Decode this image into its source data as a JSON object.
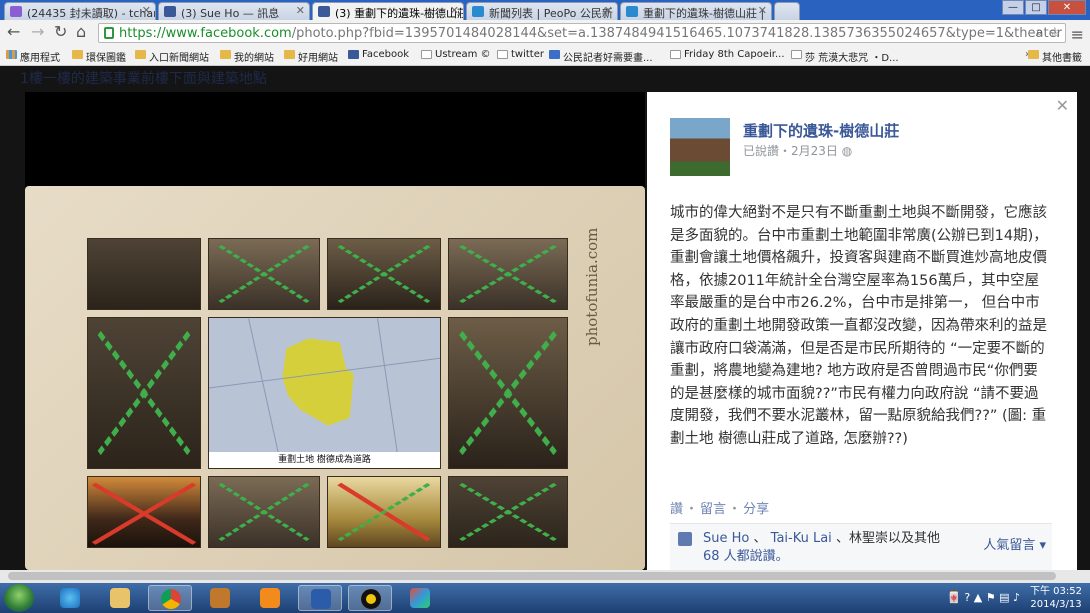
{
  "browser": {
    "tabs": [
      {
        "label": "(24435 封未讀取) - tchan",
        "icon": "gmail-icon",
        "color": "#8a5fd1"
      },
      {
        "label": "(3) Sue Ho — 訊息",
        "icon": "facebook-icon",
        "color": "#3b5998"
      },
      {
        "label": "(3) 重劃下的遺珠-樹德山莊",
        "icon": "facebook-icon",
        "color": "#3b5998"
      },
      {
        "label": "新聞列表 | PeoPo 公民新",
        "icon": "peopo-icon",
        "color": "#2a8ad0"
      },
      {
        "label": "重劃下的遺珠-樹德山莊 |",
        "icon": "peopo-icon",
        "color": "#2a8ad0"
      }
    ],
    "url_host": "https://www.facebook.com",
    "url_rest": "/photo.php?fbid=1395701484028144&set=a.1387484941516465.1073741828.1385736355024657&type=1&theater",
    "bookmarks": [
      {
        "label": "應用程式",
        "icon": "apps-icon"
      },
      {
        "label": "環保圖鑑",
        "icon": "folder-icon"
      },
      {
        "label": "入口新聞網站",
        "icon": "folder-icon"
      },
      {
        "label": "我的網站",
        "icon": "folder-icon"
      },
      {
        "label": "好用網站",
        "icon": "folder-icon"
      },
      {
        "label": "Facebook",
        "icon": "facebook-icon"
      },
      {
        "label": "Ustream ©",
        "icon": "page-icon"
      },
      {
        "label": "twitter",
        "icon": "page-icon"
      },
      {
        "label": "公民記者好需要畫...",
        "icon": "u-icon"
      },
      {
        "label": "Friday 8th Capoeir...",
        "icon": "page-icon"
      },
      {
        "label": "莎 荒漠大悲咒 ・D...",
        "icon": "page-icon"
      },
      {
        "label": "其他書籤",
        "icon": "folder-icon"
      }
    ]
  },
  "facebook": {
    "dim_header": "1樓一樓的建築事業前樓下面與建築地點",
    "watermark": "photofunia.com",
    "map_label": "重劃土地 樹德成為道路",
    "post": {
      "page_name": "重劃下的遺珠-樹德山莊",
      "meta": "已說讚・2月23日",
      "text": "城市的偉大絕對不是只有不斷重劃土地與不斷開發，它應該是多面貌的。台中市重劃土地範圍非常廣(公辦已到14期)，重劃會讓土地價格飆升，投資客與建商不斷買進炒高地皮價格，依據2011年統計全台灣空屋率為156萬戶，其中空屋率最嚴重的是台中市26.2%，台中市是排第一， 但台中市政府的重劃土地開發政策一直都沒改變，因為帶來利的益是讓市政府口袋滿滿，但是否是市民所期待的 “一定要不斷的重劃，將農地變為建地? 地方政府是否曾問過市民“你們要的是甚麼樣的城市面貌??”市民有權力向政府說 “請不要過度開發，我們不要水泥叢林，留一點原貌給我們??” (圖: 重劃土地 樹德山莊成了道路, 怎麼辦??)",
      "action_like": "讚",
      "action_comment": "留言",
      "action_share": "分享",
      "likers_1": "Sue Ho",
      "likers_sep1": "、",
      "likers_2": "Tai-Ku Lai",
      "likers_rest": "、林聖崇以及其他",
      "likers_count": "68 人都說讚。",
      "popular_comments": "人氣留言"
    }
  },
  "taskbar": {
    "clock_time": "下午 03:52",
    "clock_date": "2014/3/13",
    "apps": [
      "ie-icon",
      "explorer-icon",
      "chrome-icon",
      "winamp-icon",
      "media-player-icon",
      "word-icon",
      "circle-app-icon",
      "paint-icon"
    ]
  },
  "colors": {
    "fb_blue": "#3b5998",
    "cross_green": "#3fae4b",
    "cross_red": "#d93a2a"
  }
}
